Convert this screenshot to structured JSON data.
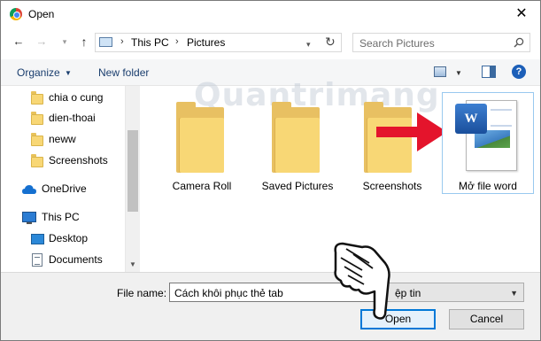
{
  "window": {
    "title": "Open",
    "close_symbol": "✕"
  },
  "nav_buttons": {
    "back": "←",
    "forward": "→",
    "recent": "▾",
    "up": "↑"
  },
  "address": {
    "parts": [
      "This PC",
      "Pictures"
    ],
    "separator": "›"
  },
  "search": {
    "placeholder": "Search Pictures"
  },
  "toolbar": {
    "organize_label": "Organize",
    "new_folder_label": "New folder",
    "help_symbol": "?"
  },
  "sidebar": {
    "items": [
      {
        "label": "chia o cung",
        "icon": "folder-icon"
      },
      {
        "label": "dien-thoai",
        "icon": "folder-icon"
      },
      {
        "label": "neww",
        "icon": "folder-icon"
      },
      {
        "label": "Screenshots",
        "icon": "folder-icon"
      },
      {
        "label": "OneDrive",
        "icon": "cloud-icon"
      },
      {
        "label": "This PC",
        "icon": "computer-icon"
      },
      {
        "label": "Desktop",
        "icon": "desktop-icon"
      },
      {
        "label": "Documents",
        "icon": "documents-icon"
      }
    ]
  },
  "files": [
    {
      "name": "Camera Roll",
      "type": "folder"
    },
    {
      "name": "Saved Pictures",
      "type": "folder"
    },
    {
      "name": "Screenshots",
      "type": "folder"
    },
    {
      "name": "Mở file word",
      "type": "word-document",
      "selected": true
    }
  ],
  "watermark": "Quantrimang",
  "bottom": {
    "file_name_label": "File name:",
    "file_name_value": "Cách khôi phục thẻ tab",
    "file_type_value": "ệp tin",
    "open_label": "Open",
    "cancel_label": "Cancel"
  },
  "colors": {
    "accent": "#0078d7",
    "folder": "#f8d775",
    "arrow": "#e4142c",
    "selection_border": "#99c9ef"
  }
}
